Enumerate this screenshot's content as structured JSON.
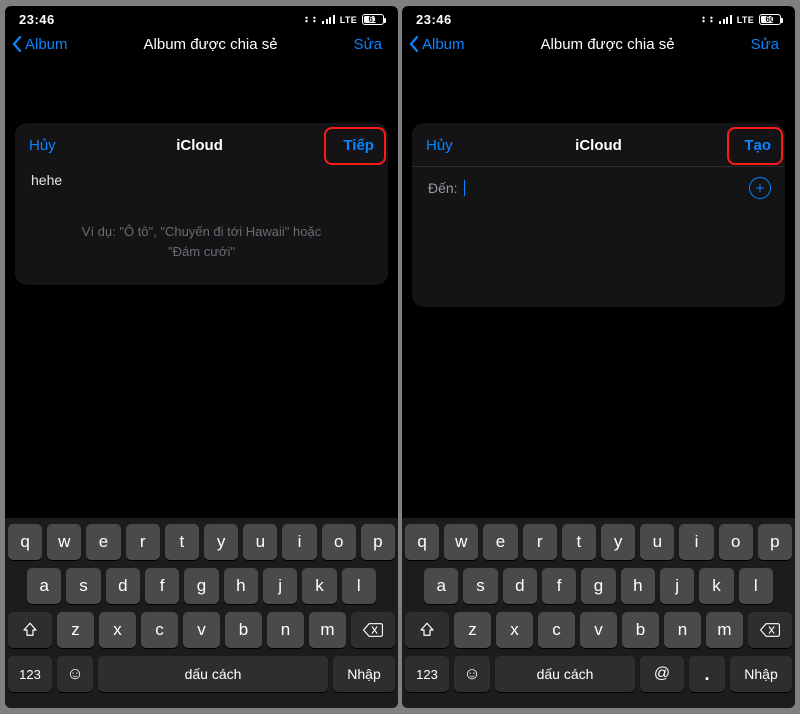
{
  "screens": [
    {
      "statusbar": {
        "time": "23:46",
        "cellular": "LTE",
        "battery_pct": 61
      },
      "nav": {
        "back_label": "Album",
        "title": "Album được chia sẻ",
        "right_label": "Sửa"
      },
      "sheet": {
        "cancel": "Hủy",
        "title": "iCloud",
        "action": "Tiếp",
        "name_value": "hehe",
        "hint_line1": "Ví dụ: \"Ô tô\", \"Chuyến đi tới Hawaii\" hoặc",
        "hint_line2": "\"Đám cưới\""
      },
      "keyboard": {
        "row1": [
          "q",
          "w",
          "e",
          "r",
          "t",
          "y",
          "u",
          "i",
          "o",
          "p"
        ],
        "row2": [
          "a",
          "s",
          "d",
          "f",
          "g",
          "h",
          "j",
          "k",
          "l"
        ],
        "row3": [
          "z",
          "x",
          "c",
          "v",
          "b",
          "n",
          "m"
        ],
        "num": "123",
        "space": "dấu cách",
        "enter": "Nhập"
      }
    },
    {
      "statusbar": {
        "time": "23:46",
        "cellular": "LTE",
        "battery_pct": 60
      },
      "nav": {
        "back_label": "Album",
        "title": "Album được chia sẻ",
        "right_label": "Sửa"
      },
      "sheet": {
        "cancel": "Hủy",
        "title": "iCloud",
        "action": "Tạo",
        "to_label": "Đến:"
      },
      "keyboard": {
        "row1": [
          "q",
          "w",
          "e",
          "r",
          "t",
          "y",
          "u",
          "i",
          "o",
          "p"
        ],
        "row2": [
          "a",
          "s",
          "d",
          "f",
          "g",
          "h",
          "j",
          "k",
          "l"
        ],
        "row3": [
          "z",
          "x",
          "c",
          "v",
          "b",
          "n",
          "m"
        ],
        "num": "123",
        "space": "dấu cách",
        "at": "@",
        "dot": ".",
        "enter": "Nhập"
      }
    }
  ]
}
